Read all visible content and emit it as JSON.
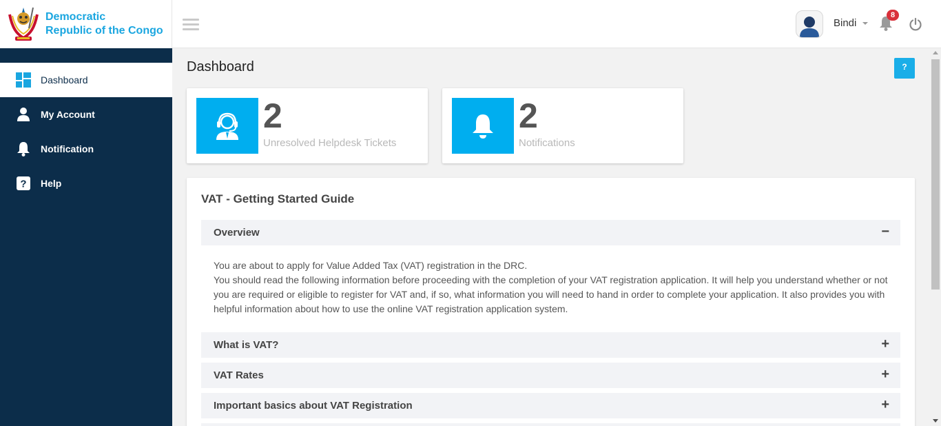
{
  "brand": {
    "line1": "Democratic",
    "line2": "Republic of the Congo",
    "logo_icon": "coat-of-arms-icon"
  },
  "sidebar": {
    "items": [
      {
        "label": "Dashboard",
        "icon": "dashboard-grid-icon",
        "active": true
      },
      {
        "label": "My Account",
        "icon": "user-icon",
        "active": false
      },
      {
        "label": "Notification",
        "icon": "bell-icon",
        "active": false
      },
      {
        "label": "Help",
        "icon": "question-icon",
        "active": false
      }
    ]
  },
  "topbar": {
    "username": "Bindi",
    "notification_count": "8",
    "icons": [
      "hamburger-menu-icon",
      "avatar",
      "bell-icon",
      "power-icon"
    ]
  },
  "main": {
    "title": "Dashboard",
    "help_button_label": "?",
    "stats": [
      {
        "value": "2",
        "label": "Unresolved Helpdesk Tickets",
        "icon": "helpdesk-agent-icon"
      },
      {
        "value": "2",
        "label": "Notifications",
        "icon": "bell-icon"
      }
    ],
    "guide": {
      "title": "VAT - Getting Started Guide",
      "sections": [
        {
          "label": "Overview",
          "sign": "−",
          "expanded": true
        },
        {
          "label": "What is VAT?",
          "sign": "+",
          "expanded": false
        },
        {
          "label": "VAT Rates",
          "sign": "+",
          "expanded": false
        },
        {
          "label": "Important basics about VAT Registration",
          "sign": "+",
          "expanded": false
        }
      ],
      "overview_text": [
        "You are about to apply for Value Added Tax (VAT) registration in the DRC.",
        "You should read the following information before proceeding with the completion of your VAT registration application. It will help you understand whether or not you are required or eligible to register for VAT and, if so, what information you will need to hand in order to complete your application. It also provides you with helpful information about how to use the online VAT registration application system."
      ]
    }
  },
  "colors": {
    "sidebar_bg": "#0c2d4a",
    "accent": "#00aeef",
    "brand_text": "#1aa6e0",
    "badge": "#d9303a"
  }
}
